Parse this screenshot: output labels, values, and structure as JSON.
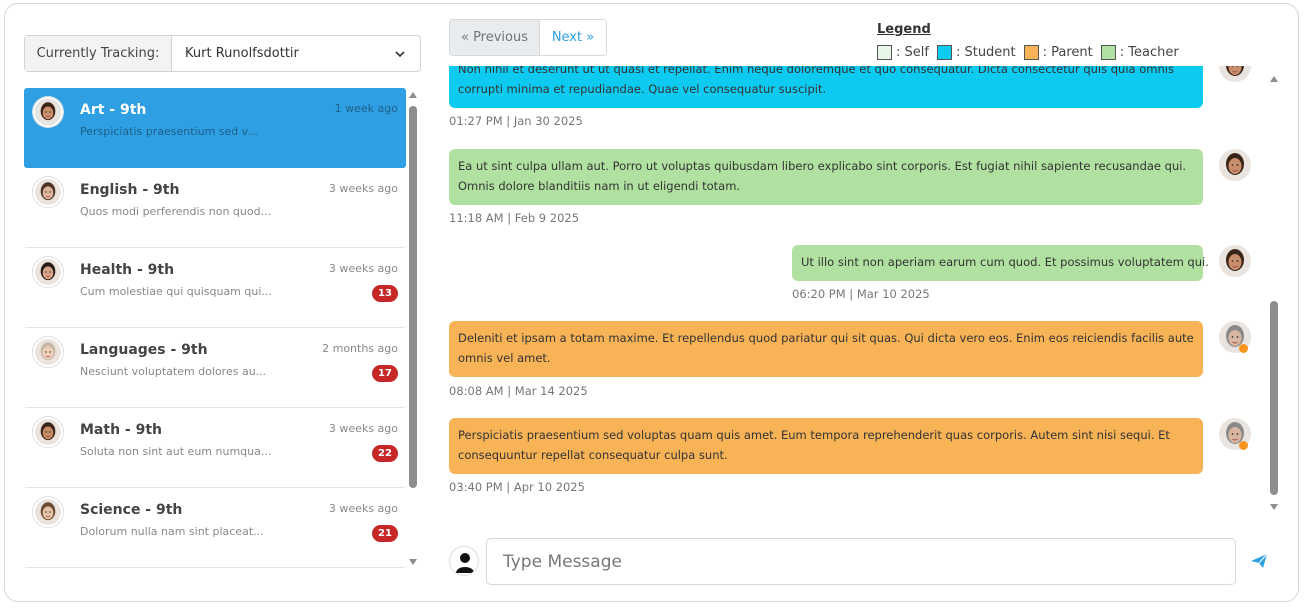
{
  "tracking": {
    "label": "Currently Tracking:",
    "value": "Kurt Runolfsdottir"
  },
  "threads": [
    {
      "title": "Art - 9th",
      "preview": "Perspiciatis praesentium sed v...",
      "time": "1 week ago",
      "badge": "",
      "active": true,
      "avatar": "female-1"
    },
    {
      "title": "English - 9th",
      "preview": "Quos modi perferendis non quod...",
      "time": "3 weeks ago",
      "badge": "",
      "active": false,
      "avatar": "female-2"
    },
    {
      "title": "Health - 9th",
      "preview": "Cum molestiae qui quisquam qui...",
      "time": "3 weeks ago",
      "badge": "13",
      "active": false,
      "avatar": "female-3"
    },
    {
      "title": "Languages - 9th",
      "preview": "Nesciunt voluptatem dolores au...",
      "time": "2 months ago",
      "badge": "17",
      "active": false,
      "avatar": "male-1"
    },
    {
      "title": "Math - 9th",
      "preview": "Soluta non sint aut eum numqua...",
      "time": "3 weeks ago",
      "badge": "22",
      "active": false,
      "avatar": "female-4"
    },
    {
      "title": "Science - 9th",
      "preview": "Dolorum nulla nam sint placeat...",
      "time": "3 weeks ago",
      "badge": "21",
      "active": false,
      "avatar": "female-5"
    }
  ],
  "pager": {
    "prev": "« Previous",
    "next": "Next »"
  },
  "legend": {
    "title": "Legend",
    "items": [
      {
        "label": ": Self",
        "color": "#e8f5e9"
      },
      {
        "label": ": Student",
        "color": "#0dcaf0"
      },
      {
        "label": ": Parent",
        "color": "#f8b357"
      },
      {
        "label": ": Teacher",
        "color": "#b1e1a0"
      }
    ]
  },
  "messages": [
    {
      "text_line1": "Non nihil et deserunt ut ut quasi et repellat. Enim neque doloremque et quo consequatur. Dicta consectetur quis quia omnis",
      "text_line2": "corrupti minima et repudiandae. Quae vel consequatur suscipit.",
      "meta": "01:27 PM | Jan 30 2025",
      "role": "student",
      "color": "#0dcaf0"
    },
    {
      "text_line1": "Ea ut sint culpa ullam aut. Porro ut voluptas quibusdam libero explicabo sint corporis. Est fugiat nihil sapiente recusandae qui.",
      "text_line2": "Omnis dolore blanditiis nam in ut eligendi totam.",
      "meta": "11:18 AM | Feb 9 2025",
      "role": "teacher",
      "color": "#b1e1a0"
    },
    {
      "text_line1": "Ut illo sint non aperiam earum cum quod. Et possimus voluptatem qui.",
      "text_line2": "",
      "meta": "06:20 PM | Mar 10 2025",
      "role": "teacher",
      "color": "#b1e1a0"
    },
    {
      "text_line1": "Deleniti et ipsam a totam maxime. Et repellendus quod pariatur qui sit quas. Qui dicta vero eos. Enim eos reiciendis facilis autem",
      "text_line2": "omnis vel amet.",
      "meta": "08:08 AM | Mar 14 2025",
      "role": "parent",
      "color": "#f8b357"
    },
    {
      "text_line1": "Perspiciatis praesentium sed voluptas quam quis amet. Eum tempora reprehenderit quas corporis. Autem sint nisi sequi. Et",
      "text_line2": "consequuntur repellat consequatur culpa sunt.",
      "meta": "03:40 PM | Apr 10 2025",
      "role": "parent",
      "color": "#f8b357"
    }
  ],
  "composer": {
    "placeholder": "Type Message"
  }
}
